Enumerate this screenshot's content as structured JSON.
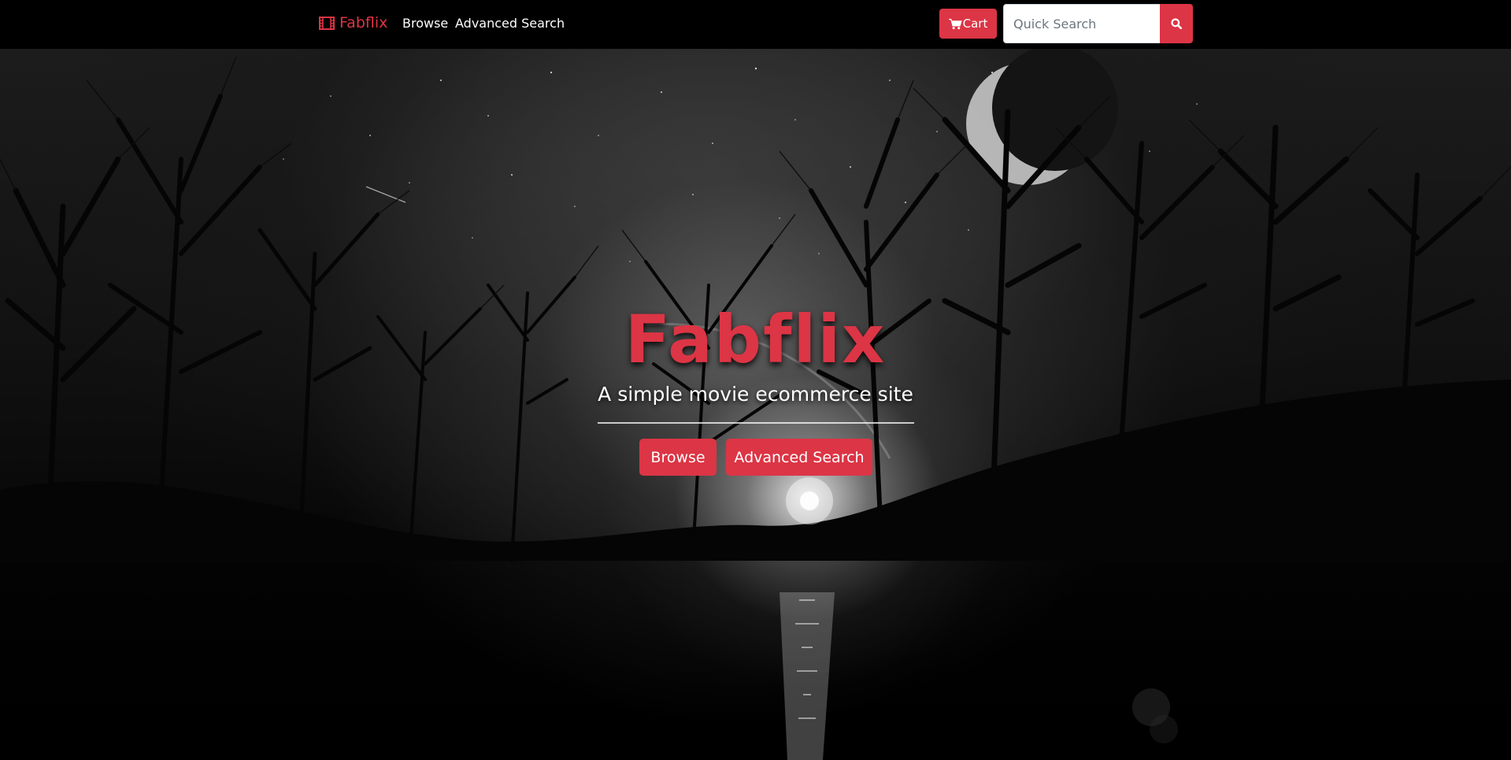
{
  "navbar": {
    "brand": "Fabflix",
    "brand_icon": "film-icon",
    "links": [
      "Browse",
      "Advanced Search"
    ],
    "cart_label": "Cart",
    "cart_icon": "cart-icon",
    "search_placeholder": "Quick Search",
    "search_icon": "search-icon"
  },
  "hero": {
    "title": "Fabflix",
    "subtitle": "A simple movie ecommerce site",
    "buttons": [
      "Browse",
      "Advanced Search"
    ]
  },
  "colors": {
    "accent": "#dc3545",
    "navbar_bg": "#000000",
    "text": "#ffffff"
  }
}
